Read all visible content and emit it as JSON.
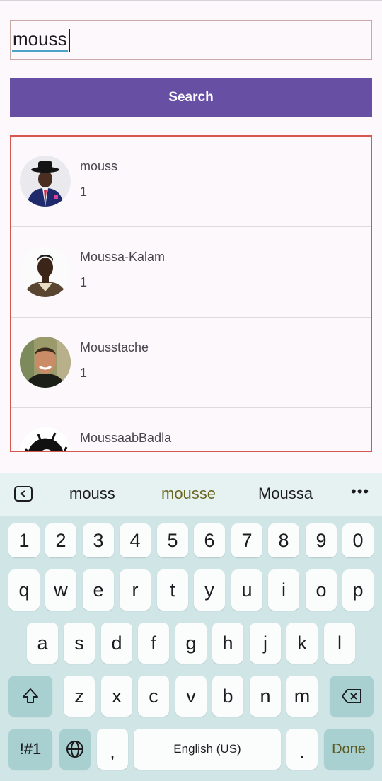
{
  "search": {
    "value": "mouss",
    "button_label": "Search"
  },
  "results": [
    {
      "name": "mouss",
      "count": "1",
      "avatar_icon": "avatar-man-hat-icon"
    },
    {
      "name": "Moussa-Kalam",
      "count": "1",
      "avatar_icon": "avatar-man-icon"
    },
    {
      "name": "Mousstache",
      "count": "1",
      "avatar_icon": "avatar-smiling-man-icon"
    },
    {
      "name": "MoussaabBadla",
      "count": "",
      "avatar_icon": "avatar-illustration-icon"
    }
  ],
  "keyboard": {
    "suggestions": [
      "mouss",
      "mousse",
      "Moussa"
    ],
    "row_numbers": [
      "1",
      "2",
      "3",
      "4",
      "5",
      "6",
      "7",
      "8",
      "9",
      "0"
    ],
    "row1": [
      "q",
      "w",
      "e",
      "r",
      "t",
      "y",
      "u",
      "i",
      "o",
      "p"
    ],
    "row2": [
      "a",
      "s",
      "d",
      "f",
      "g",
      "h",
      "j",
      "k",
      "l"
    ],
    "row3": [
      "z",
      "x",
      "c",
      "v",
      "b",
      "n",
      "m"
    ],
    "symbols_label": "!#1",
    "comma_label": ",",
    "space_label": "English (US)",
    "period_label": ".",
    "done_label": "Done"
  },
  "colors": {
    "accent": "#6750a4",
    "results_border": "#d7574f",
    "keyboard_bg": "#cfe5e6"
  }
}
